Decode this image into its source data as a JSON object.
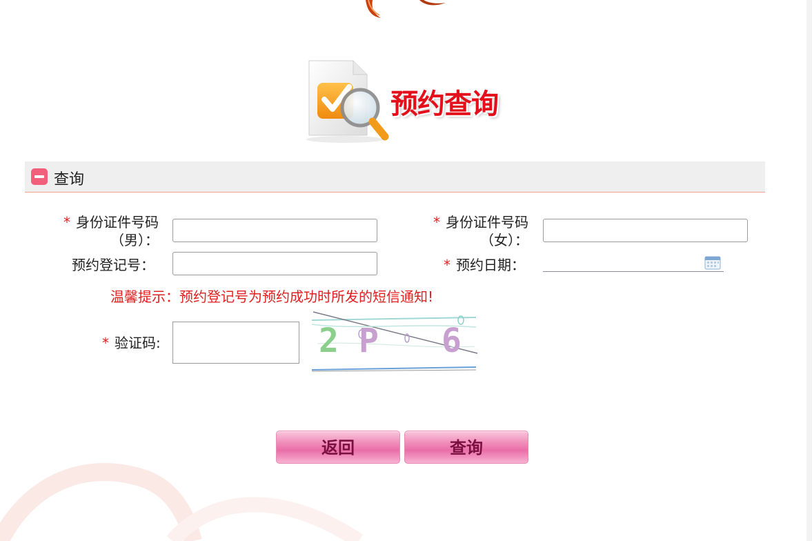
{
  "header": {
    "logo_title": "预约查询"
  },
  "section": {
    "title": "查询"
  },
  "form": {
    "id_male": {
      "label_line1": "身份证件号码",
      "label_line2": "（男）：",
      "value": ""
    },
    "id_female": {
      "label_line1": "身份证件号码",
      "label_line2": "（女）：",
      "value": ""
    },
    "reg_no": {
      "label": "预约登记号：",
      "value": ""
    },
    "date": {
      "label": "预约日期：",
      "value": ""
    },
    "tip": "温馨提示：预约登记号为预约成功时所发的短信通知!",
    "captcha": {
      "label": "验证码:",
      "value": "",
      "image_text": "2P6"
    },
    "required_mark": "*"
  },
  "buttons": {
    "back": "返回",
    "query": "查询"
  },
  "colors": {
    "accent_red": "#e02020",
    "button_pink": "#ea6ea8",
    "collapse_icon": "#f25f7d",
    "header_bg": "#efefef"
  },
  "icons": [
    "collapse-icon",
    "calendar-icon",
    "magnifier-check-icon"
  ]
}
